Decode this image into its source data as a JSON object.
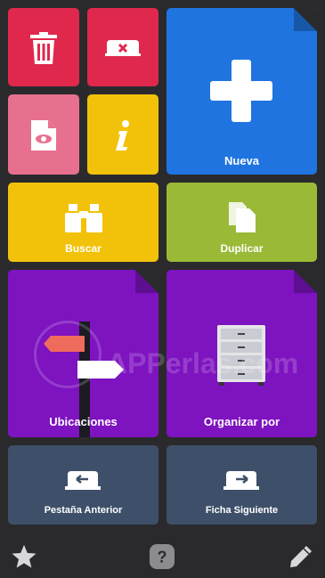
{
  "tiles": {
    "nueva": "Nueva",
    "buscar": "Buscar",
    "duplicar": "Duplicar",
    "ubicaciones": "Ubicaciones",
    "organizar": "Organizar por",
    "anterior": "Pestaña Anterior",
    "siguiente": "Ficha Siguiente"
  },
  "watermark": "APPerlas.com",
  "colors": {
    "red": "#e0284d",
    "pink": "#e8708f",
    "yellow": "#f2c20a",
    "blue": "#1f74e0",
    "green": "#9ab936",
    "purple": "#7e13c0",
    "slate": "#3e5069",
    "background": "#2a2a2c"
  },
  "icons": [
    "trash-icon",
    "close-tab-icon",
    "document-eye-icon",
    "info-icon",
    "plus-icon",
    "binoculars-icon",
    "duplicate-icon",
    "signpost-icon",
    "cabinet-icon",
    "tab-back-icon",
    "tab-forward-icon",
    "star-icon",
    "help-icon",
    "pencil-icon"
  ]
}
